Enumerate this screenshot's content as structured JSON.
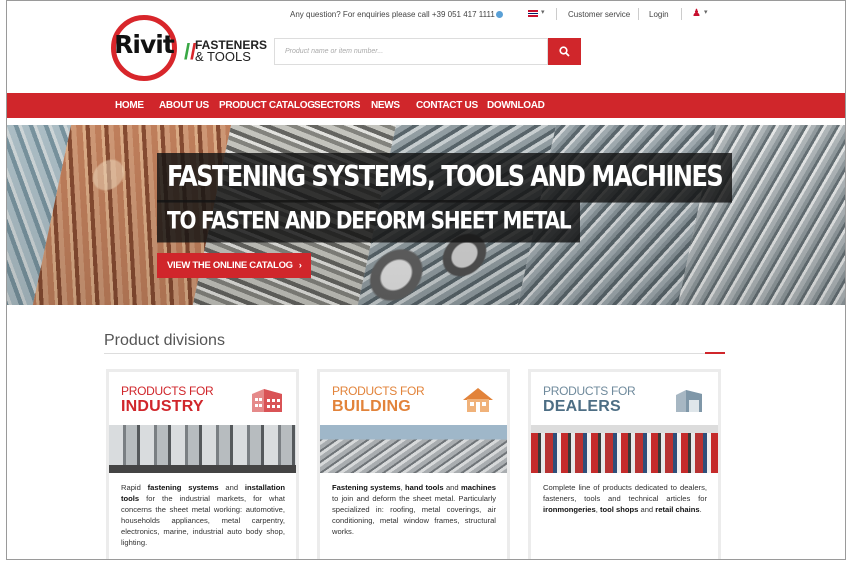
{
  "topbar": {
    "enquiry": "Any question? For enquiries please call +39 051 417 1111",
    "language_flag": "uk-flag-icon",
    "customer_service": "Customer service",
    "login": "Login",
    "user_icon": "user-icon"
  },
  "logo": {
    "wordmark": "Rivit",
    "line1": "FASTENERS",
    "line2": "& TOOLS"
  },
  "search": {
    "placeholder": "Product name or item number...",
    "icon": "search-icon"
  },
  "nav": {
    "items": [
      "HOME",
      "ABOUT US",
      "PRODUCT CATALOG",
      "SECTORS",
      "NEWS",
      "CONTACT US",
      "DOWNLOAD"
    ]
  },
  "hero": {
    "title_line1": "FASTENING SYSTEMS, TOOLS AND MACHINES",
    "title_line2": "TO FASTEN AND DEFORM SHEET METAL",
    "cta": "VIEW THE ONLINE CATALOG",
    "cta_icon": "›"
  },
  "divisions": {
    "title": "Product divisions",
    "cards": [
      {
        "kicker": "PRODUCTS FOR",
        "name": "INDUSTRY",
        "icon": "factory-icon",
        "text": [
          {
            "t": "Rapid ",
            "b": false
          },
          {
            "t": "fastening systems",
            "b": true
          },
          {
            "t": " and ",
            "b": false
          },
          {
            "t": "installation tools",
            "b": true
          },
          {
            "t": " for the industrial markets, for what concerns the sheet metal working: automotive, households appliances, metal carpentry, electronics, marine, industrial auto body shop, lighting.",
            "b": false
          }
        ]
      },
      {
        "kicker": "PRODUCTS FOR",
        "name": "BUILDING",
        "icon": "house-icon",
        "text": [
          {
            "t": "Fastening systems",
            "b": true
          },
          {
            "t": ", ",
            "b": false
          },
          {
            "t": "hand tools",
            "b": true
          },
          {
            "t": " and ",
            "b": false
          },
          {
            "t": "machines",
            "b": true
          },
          {
            "t": " to join and deform the sheet metal. Particularly specialized in: roofing, metal coverings, air conditioning, metal window frames, structural works.",
            "b": false
          }
        ]
      },
      {
        "kicker": "PRODUCTS FOR",
        "name": "DEALERS",
        "icon": "warehouse-icon",
        "text": [
          {
            "t": "Complete line of products dedicated to dealers, fasteners, tools and technical articles for ",
            "b": false
          },
          {
            "t": "ironmongeries",
            "b": true
          },
          {
            "t": ", ",
            "b": false
          },
          {
            "t": "tool shops",
            "b": true
          },
          {
            "t": " and ",
            "b": false
          },
          {
            "t": "retail chains",
            "b": true
          },
          {
            "t": ".",
            "b": false
          }
        ]
      }
    ]
  },
  "colors": {
    "brand_red": "#d0262b",
    "building_orange": "#e2833a",
    "dealers_blue": "#4d6e84"
  }
}
